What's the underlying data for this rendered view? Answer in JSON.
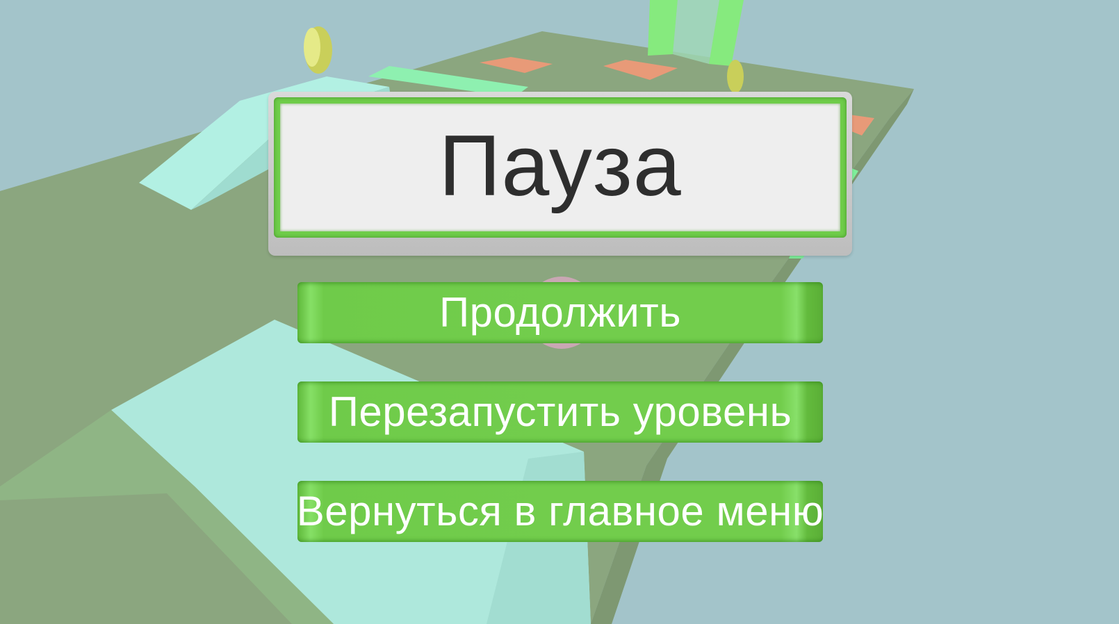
{
  "pause_menu": {
    "title": "Пауза",
    "buttons": {
      "resume": "Продолжить",
      "restart": "Перезапустить уровень",
      "main_menu": "Вернуться в главное меню"
    }
  },
  "colors": {
    "sky": "#a3c4ca",
    "platform": "#8aa57e",
    "ramp": "#b0ece2",
    "button_green": "#72cd4c",
    "title_text": "#2e2e2e",
    "button_text": "#ffffff"
  }
}
